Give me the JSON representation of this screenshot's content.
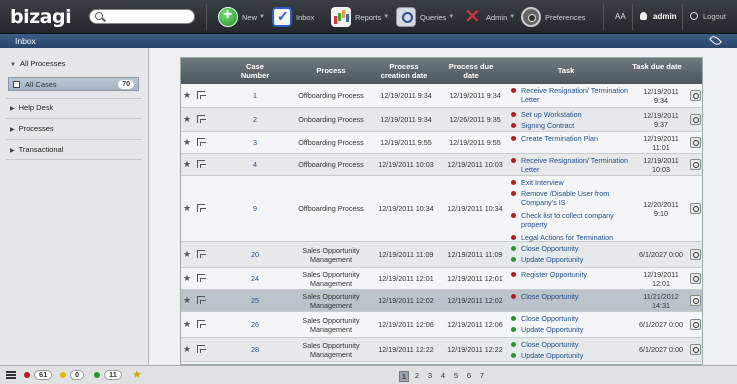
{
  "app": {
    "logo": "bizagi"
  },
  "search": {
    "placeholder": "",
    "value": ""
  },
  "nav": {
    "new": "New",
    "inbox": "Inbox",
    "reports": "Reports",
    "queries": "Queries",
    "admin": "Admin",
    "preferences": "Preferences",
    "font_size": "AA",
    "user": "admin",
    "logout": "Logout"
  },
  "subbar": {
    "title": "Inbox"
  },
  "sidebar": {
    "all_processes": "All Processes",
    "all_cases": "All Cases",
    "all_cases_count": "70",
    "help_desk": "Help Desk",
    "processes": "Processes",
    "transactional": "Transactional"
  },
  "grid": {
    "headers": {
      "case_number": "Case Number",
      "process": "Process",
      "creation_date": "Process creation date",
      "due_date": "Process due date",
      "task": "Task",
      "task_due": "Task due date"
    },
    "rows": [
      {
        "case": "1",
        "process": "Offboarding Process",
        "created": "12/19/2011 9:34",
        "due": "12/19/2011 9:34",
        "tasks": [
          {
            "text": "Receive Resignation/ Termination Letter",
            "status": "red"
          }
        ],
        "task_due": "12/19/2011 9:34"
      },
      {
        "case": "2",
        "process": "Onboarding Process",
        "created": "12/19/2011 9:34",
        "due": "12/26/2011 9:35",
        "tasks": [
          {
            "text": "Set up Workstation",
            "status": "red"
          },
          {
            "text": "Signing Contract",
            "status": "red"
          }
        ],
        "task_due": "12/19/2011 9:37"
      },
      {
        "case": "3",
        "process": "Offboarding Process",
        "created": "12/19/2011 9:55",
        "due": "12/19/2011 9:55",
        "tasks": [
          {
            "text": "Create Termination Plan",
            "status": "red"
          }
        ],
        "task_due": "12/19/2011 11:01"
      },
      {
        "case": "4",
        "process": "Offboarding Process",
        "created": "12/19/2011 10:03",
        "due": "12/19/2011 10:03",
        "tasks": [
          {
            "text": "Receive Resignation/ Termination Letter",
            "status": "red"
          }
        ],
        "task_due": "12/19/2011 10:03"
      },
      {
        "case": "9",
        "process": "Offboarding Process",
        "created": "12/19/2011 10:34",
        "due": "12/19/2011 10:34",
        "tasks": [
          {
            "text": "Exit Interview",
            "status": "red"
          },
          {
            "text": "Remove /Disable User from Company's IS",
            "status": "red"
          },
          {
            "text": "Check list to collect company property",
            "status": "red"
          },
          {
            "text": "Legal Actions for Termination",
            "status": "red"
          }
        ],
        "task_due": "12/20/2011 9:10"
      },
      {
        "case": "20",
        "process": "Sales Opportunity Management",
        "created": "12/19/2011 11:09",
        "due": "12/19/2011 11:09",
        "tasks": [
          {
            "text": "Close Opportunity",
            "status": "green"
          },
          {
            "text": "Update Opportunity",
            "status": "green"
          }
        ],
        "task_due": "6/1/2027 0:00"
      },
      {
        "case": "24",
        "process": "Sales Opportunity Management",
        "created": "12/19/2011 12:01",
        "due": "12/19/2011 12:01",
        "tasks": [
          {
            "text": "Register Opportunity",
            "status": "red"
          }
        ],
        "task_due": "12/19/2011 12:01"
      },
      {
        "case": "25",
        "process": "Sales Opportunity Management",
        "created": "12/19/2011 12:02",
        "due": "12/19/2011 12:02",
        "tasks": [
          {
            "text": "Close Opportunity",
            "status": "red"
          }
        ],
        "task_due": "11/21/2012 14:31"
      },
      {
        "case": "26",
        "process": "Sales Opportunity Management",
        "created": "12/19/2011 12:06",
        "due": "12/19/2011 12:06",
        "tasks": [
          {
            "text": "Close Opportunity",
            "status": "green"
          },
          {
            "text": "Update Opportunity",
            "status": "green"
          }
        ],
        "task_due": "6/1/2027 0:00"
      },
      {
        "case": "28",
        "process": "Sales Opportunity Management",
        "created": "12/19/2011 12:22",
        "due": "12/19/2011 12:22",
        "tasks": [
          {
            "text": "Close Opportunity",
            "status": "green"
          },
          {
            "text": "Update Opportunity",
            "status": "green"
          }
        ],
        "task_due": "6/1/2027 0:00"
      }
    ]
  },
  "footer": {
    "red_count": "61",
    "yellow_count": "0",
    "green_count": "11",
    "pages": [
      "1",
      "2",
      "3",
      "4",
      "5",
      "6",
      "7"
    ],
    "current_page": "1"
  },
  "colors": {
    "red": "#c0171b",
    "green": "#1f9a29",
    "yellow": "#e6b800",
    "selected_row": "#bcc3ca"
  }
}
